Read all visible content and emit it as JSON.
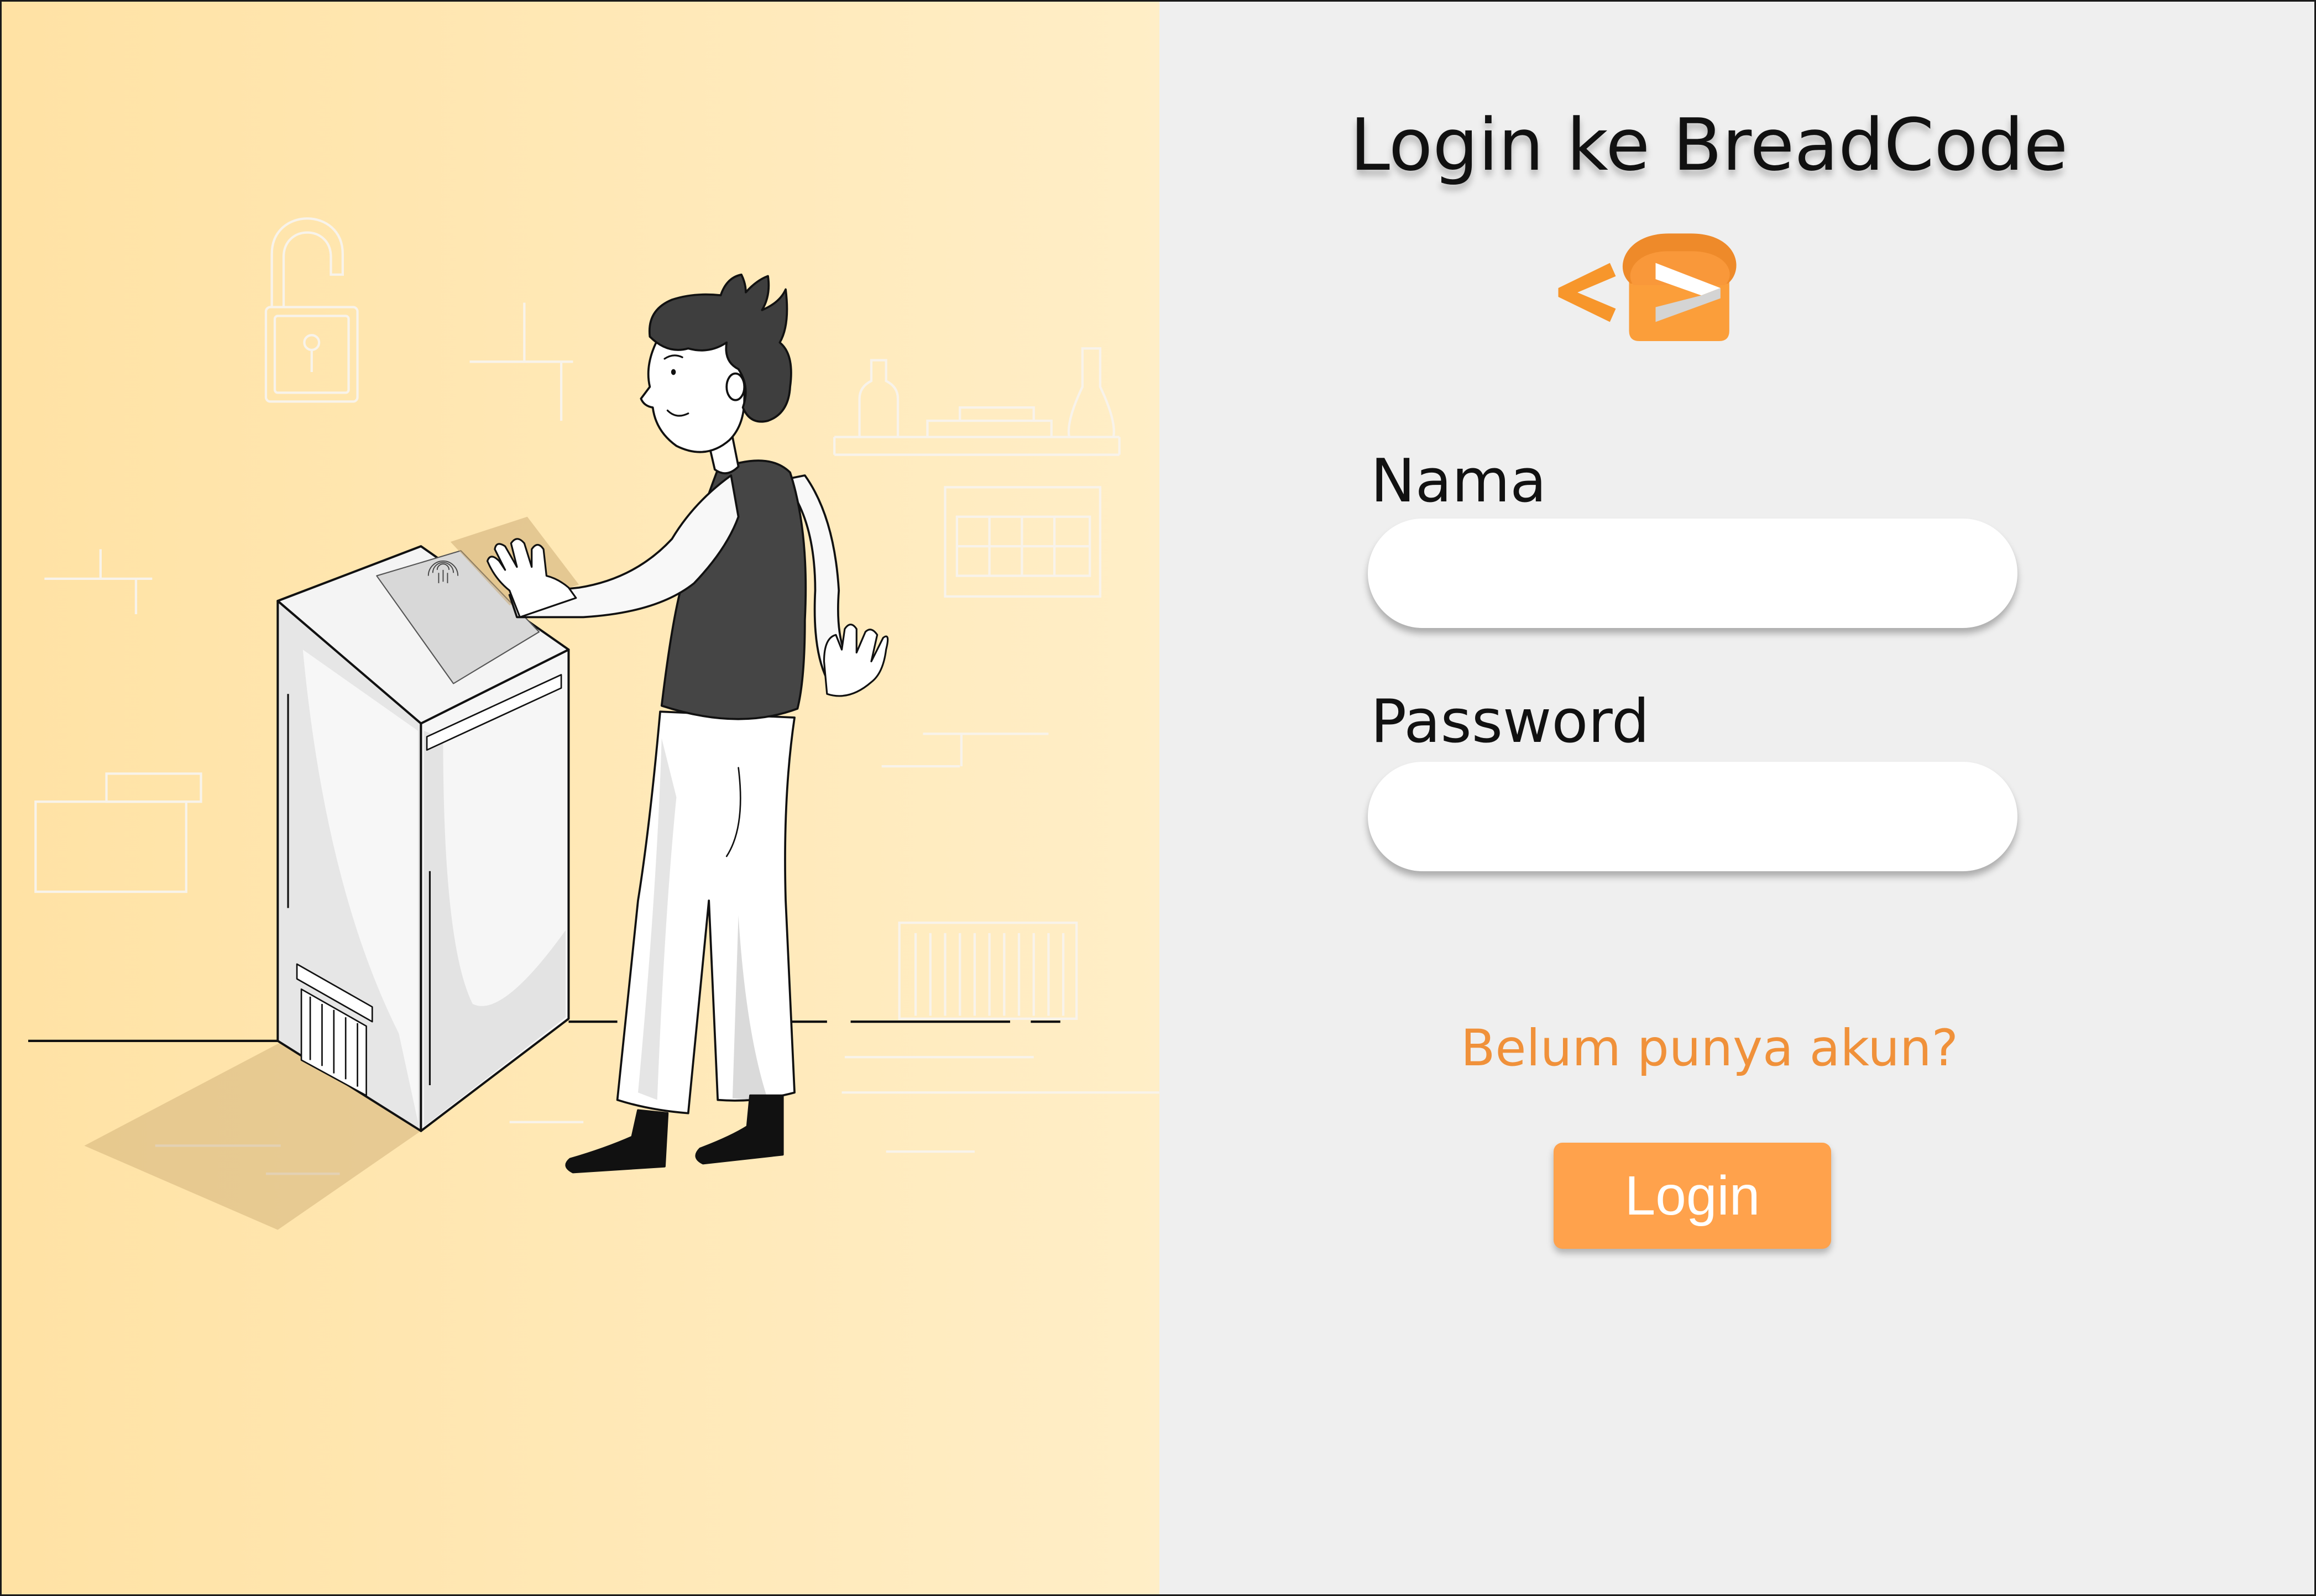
{
  "page": {
    "title": "Login ke BreadCode"
  },
  "form": {
    "nama": {
      "label": "Nama",
      "value": "",
      "placeholder": ""
    },
    "password": {
      "label": "Password",
      "value": "",
      "placeholder": ""
    },
    "register_link": "Belum punya akun?",
    "login_button": "Login"
  },
  "icons": {
    "logo": "breadcode-logo-icon",
    "padlock": "padlock-icon",
    "fingerprint": "fingerprint-icon"
  },
  "colors": {
    "accent": "#FFA24C",
    "link": "#F0913A",
    "logo-orange": "#F7962B",
    "left-bg-start": "#FFE2A4",
    "left-bg-end": "#FFEEC7",
    "right-bg": "#EFEFEF",
    "text": "#111111"
  }
}
